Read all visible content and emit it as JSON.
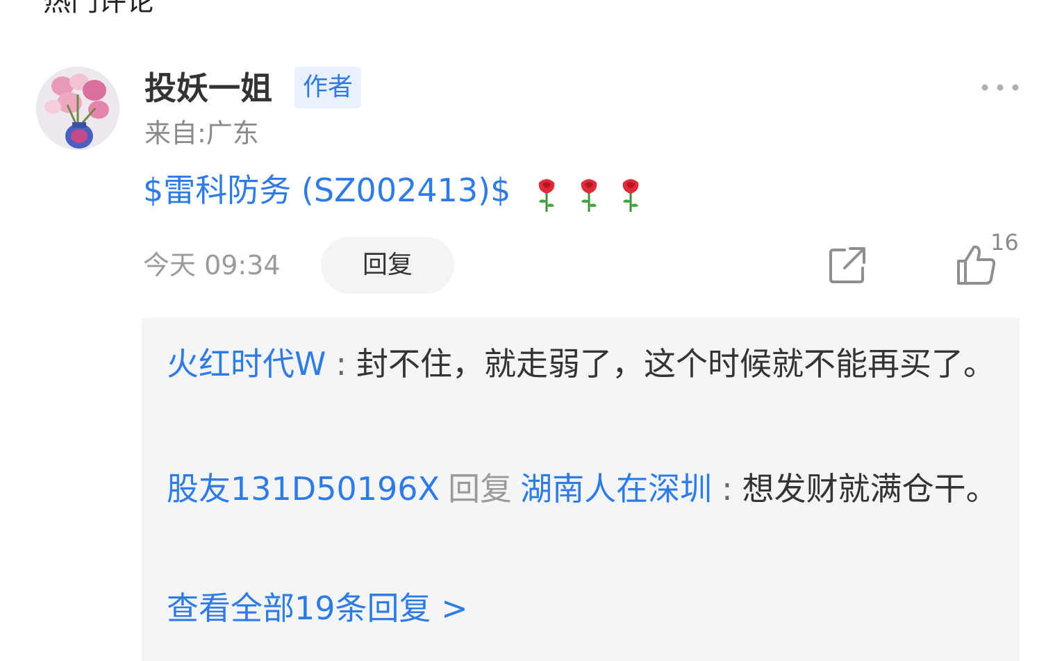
{
  "section_title": "热门评论",
  "comment": {
    "username": "投妖一姐",
    "author_badge": "作者",
    "location": "来自:广东",
    "stock_link": "$雷科防务 (SZ002413)$",
    "rose_icon_name": "rose-icon",
    "rose_count": 3,
    "timestamp": "今天 09:34",
    "reply_label": "回复",
    "like_count": "16"
  },
  "replies": [
    {
      "user": "火红时代W",
      "separator": ":",
      "text": "封不住，就走弱了，这个时候就不能再买了。"
    },
    {
      "user": "股友131D50196X",
      "reply_word": "回复",
      "target_user": "湖南人在深圳",
      "separator": ":",
      "text": "想发财就满仓干。"
    }
  ],
  "view_all": "查看全部19条回复 >",
  "colors": {
    "link_blue": "#2f7be6",
    "badge_bg": "#e8f1fd",
    "reply_box_bg": "#f4f5f7",
    "muted_gray": "#9a9a9a"
  }
}
